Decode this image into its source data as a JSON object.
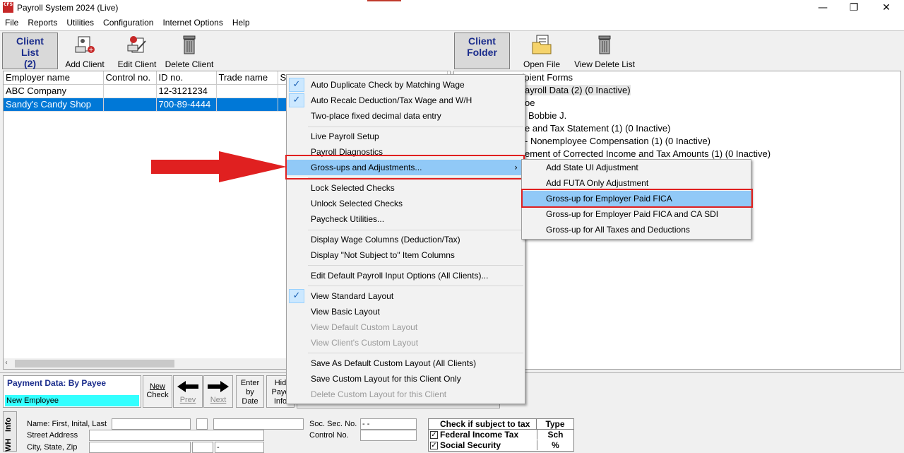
{
  "window": {
    "title": "Payroll System 2024 (Live)",
    "app_icon_text": "CFS",
    "minimize": "—",
    "maximize": "❐",
    "close": "✕"
  },
  "menubar": [
    "File",
    "Reports",
    "Utilities",
    "Configuration",
    "Internet Options",
    "Help"
  ],
  "toolbar_left": {
    "client_list": {
      "line1": "Client",
      "line2": "List",
      "line3": "(2)"
    },
    "add_client": "Add Client",
    "edit_client": "Edit Client",
    "delete_client": "Delete Client"
  },
  "toolbar_right": {
    "client_folder": {
      "line1": "Client",
      "line2": "Folder"
    },
    "open_file": "Open File",
    "view_delete_list": "View Delete List"
  },
  "client_table": {
    "columns": [
      "Employer name",
      "Control no.",
      "ID no.",
      "Trade name",
      "S"
    ],
    "rows": [
      {
        "employer": "ABC Company",
        "control": "",
        "id": "12-3121234",
        "trade": ""
      },
      {
        "employer": "Sandy's Candy Shop",
        "control": "",
        "id": "700-89-4444",
        "trade": ""
      }
    ]
  },
  "folder_tree": [
    "cipient Forms",
    "ayroll Data  (2) (0 Inactive)",
    "oe",
    "Bobbie J.",
    "e and Tax Statement  (1) (0 Inactive)",
    "- Nonemployee Compensation  (1) (0 Inactive)",
    "ement of Corrected Income and Tax Amounts  (1) (0 Inactive)"
  ],
  "context_menu": {
    "items": [
      {
        "label": "Auto Duplicate Check by Matching Wage",
        "checked": true
      },
      {
        "label": "Auto Recalc Deduction/Tax Wage and W/H",
        "checked": true
      },
      {
        "label": "Two-place fixed decimal data entry"
      },
      {
        "label": "Live Payroll Setup"
      },
      {
        "label": "Payroll Diagnostics"
      },
      {
        "label": "Gross-ups and Adjustments...",
        "submenu": true
      },
      {
        "label": "Lock Selected Checks"
      },
      {
        "label": "Unlock Selected Checks"
      },
      {
        "label": "Paycheck Utilities..."
      },
      {
        "label": "Display Wage Columns (Deduction/Tax)"
      },
      {
        "label": "Display \"Not Subject to\" Item Columns"
      },
      {
        "label": "Edit Default Payroll Input Options (All Clients)..."
      },
      {
        "label": "View Standard Layout",
        "checked": true
      },
      {
        "label": "View Basic Layout"
      },
      {
        "label": "View Default Custom Layout",
        "disabled": true
      },
      {
        "label": "View Client's Custom Layout",
        "disabled": true
      },
      {
        "label": "Save As Default Custom Layout (All Clients)"
      },
      {
        "label": "Save Custom Layout for this Client Only"
      },
      {
        "label": "Delete Custom Layout for this Client",
        "disabled": true
      }
    ],
    "check_glyph": "✓",
    "submenu_glyph": "›"
  },
  "submenu": {
    "items": [
      "Add State UI Adjustment",
      "Add FUTA Only Adjustment",
      "Gross-up for Employer Paid FICA",
      "Gross-up for Employer Paid FICA and CA SDI",
      "Gross-up for All Taxes and Deductions"
    ]
  },
  "payment": {
    "title": "Payment Data:  By Payee",
    "selected": "New Employee",
    "new_check": {
      "l1": "New",
      "l2": "Check"
    },
    "prev": "Prev",
    "next": "Next",
    "enter_by_date": {
      "l1": "Enter",
      "l2": "by",
      "l3": "Date"
    },
    "hide_payee": {
      "l1": "Hid",
      "l2": "Paye",
      "l3": "Info"
    }
  },
  "info_form": {
    "side_label": "Info",
    "side_label2": "WH",
    "name_label": "Name: First, Inital, Last",
    "street_label": "Street Address",
    "city_label": "City, State, Zip",
    "ssn_label": "Soc. Sec. No.",
    "ssn_value": " - -",
    "control_label": "Control No.",
    "city_zip_value": "-"
  },
  "tax_table": {
    "header_check": "Check if subject to tax",
    "header_type": "Type",
    "rows": [
      {
        "name": "Federal Income Tax",
        "type": "Sch"
      },
      {
        "name": "Social Security",
        "type": "%"
      }
    ]
  },
  "colors": {
    "selection": "#0078d7",
    "highlight": "#91c9f7",
    "annotation_red": "#e02020",
    "tab_text": "#1a2c8c"
  }
}
